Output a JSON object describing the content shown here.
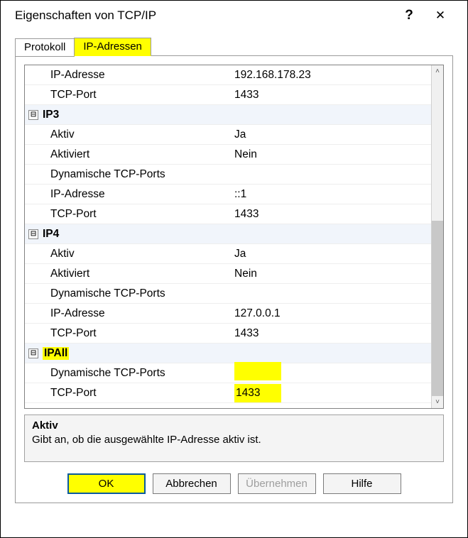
{
  "titlebar": {
    "title": "Eigenschaften von TCP/IP",
    "help": "?",
    "close": "✕"
  },
  "tabs": {
    "protokoll": "Protokoll",
    "ip_adressen": "IP-Adressen"
  },
  "rows": [
    {
      "type": "prop",
      "name": "IP-Adresse",
      "value": "192.168.178.23"
    },
    {
      "type": "prop",
      "name": "TCP-Port",
      "value": "1433"
    },
    {
      "type": "group",
      "name": "IP3"
    },
    {
      "type": "prop",
      "name": "Aktiv",
      "value": "Ja"
    },
    {
      "type": "prop",
      "name": "Aktiviert",
      "value": "Nein"
    },
    {
      "type": "prop",
      "name": "Dynamische TCP-Ports",
      "value": ""
    },
    {
      "type": "prop",
      "name": "IP-Adresse",
      "value": "::1"
    },
    {
      "type": "prop",
      "name": "TCP-Port",
      "value": "1433"
    },
    {
      "type": "group",
      "name": "IP4"
    },
    {
      "type": "prop",
      "name": "Aktiv",
      "value": "Ja"
    },
    {
      "type": "prop",
      "name": "Aktiviert",
      "value": "Nein"
    },
    {
      "type": "prop",
      "name": "Dynamische TCP-Ports",
      "value": ""
    },
    {
      "type": "prop",
      "name": "IP-Adresse",
      "value": "127.0.0.1"
    },
    {
      "type": "prop",
      "name": "TCP-Port",
      "value": "1433"
    },
    {
      "type": "group",
      "name": "IPAll",
      "hl": true
    },
    {
      "type": "prop",
      "name": "Dynamische TCP-Ports",
      "value": "",
      "hl_val": true
    },
    {
      "type": "prop",
      "name": "TCP-Port",
      "value": "1433",
      "hl_val": true
    }
  ],
  "description": {
    "title": "Aktiv",
    "text": "Gibt an, ob die ausgewählte IP-Adresse aktiv ist."
  },
  "buttons": {
    "ok": "OK",
    "cancel": "Abbrechen",
    "apply": "Übernehmen",
    "help": "Hilfe"
  },
  "scroll": {
    "up": "˄",
    "down": "˅"
  },
  "expand_glyph": "⊟"
}
